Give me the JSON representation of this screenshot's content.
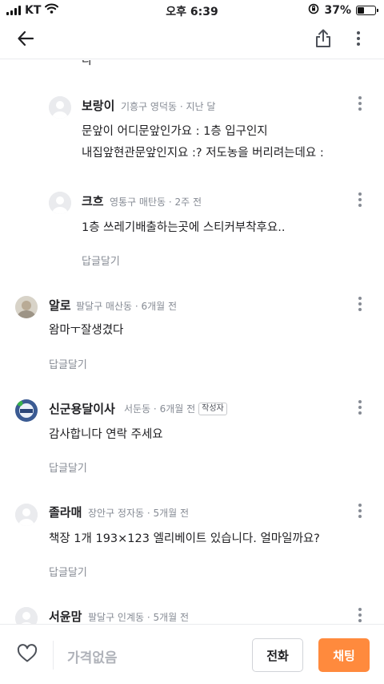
{
  "status_bar": {
    "carrier": "KT",
    "time": "오후 6:39",
    "battery": "37%",
    "battery_level": 0.37,
    "icons": [
      "signal-icon",
      "wifi-icon",
      "orientation-lock-icon",
      "battery-icon"
    ]
  },
  "header": {
    "back_icon": "arrow-left-icon",
    "share_icon": "share-icon",
    "more_icon": "more-vertical-icon"
  },
  "comments": {
    "partial": {
      "body": "다"
    },
    "c1": {
      "author": "보랑이",
      "meta": "기흥구 영덕동 · 지난 달",
      "lines": [
        "문앞이 어디문앞인가요 : 1층 입구인지",
        "내집앞현관문앞인지요 :? 저도농을 버리려는데요 :"
      ]
    },
    "c2": {
      "author": "크흐",
      "meta": "영통구 매탄동 · 2주 전",
      "lines": [
        "1층 쓰레기배출하는곳에 스티커부착후요.."
      ],
      "reply": "답글달기"
    },
    "c3": {
      "author": "알로",
      "meta": "팔달구 매산동 · 6개월 전",
      "lines": [
        "왐마ㅜ잘생겼다"
      ],
      "reply": "답글달기"
    },
    "c4": {
      "author": "신군용달이사",
      "meta": "서둔동 · 6개월 전",
      "badge": "작성자",
      "lines": [
        "감사합니다 연락 주세요"
      ],
      "reply": "답글달기"
    },
    "c5": {
      "author": "졸라매",
      "meta": "장안구 정자동 · 5개월 전",
      "lines": [
        "책장 1개 193×123  엘리베이트 있습니다. 얼마일까요?"
      ],
      "reply": "답글달기"
    },
    "c6": {
      "author": "서윤맘",
      "meta": "팔달구 인계동 · 5개월 전"
    }
  },
  "bottom_bar": {
    "heart_icon": "heart-outline-icon",
    "price": "가격없음",
    "call_label": "전화",
    "chat_label": "채팅",
    "accent": "#ff8a3d"
  }
}
